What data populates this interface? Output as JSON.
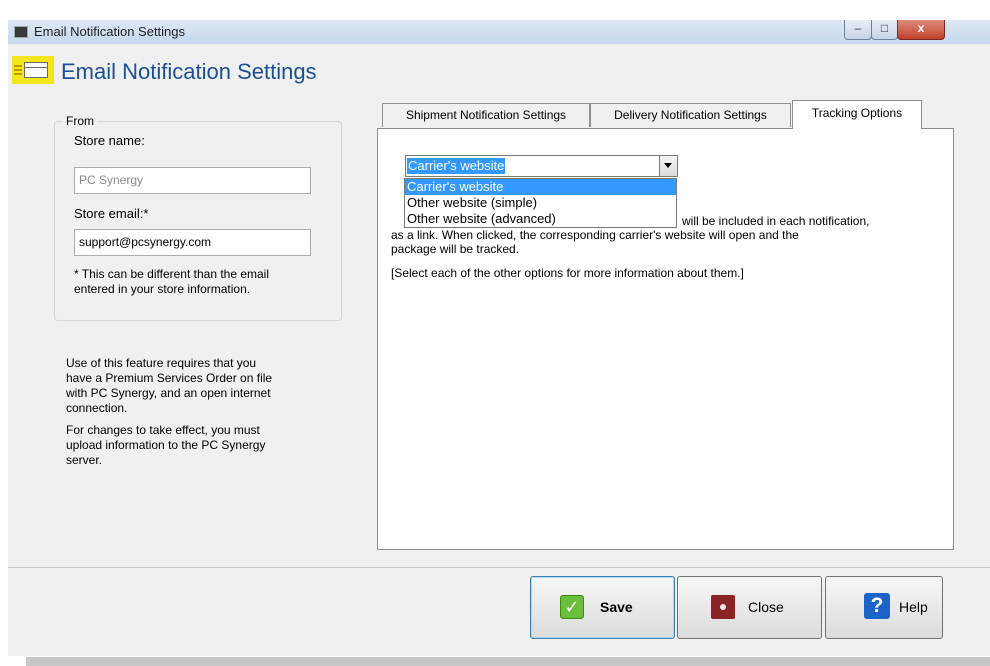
{
  "window": {
    "title": "Email Notification Settings",
    "controls": {
      "minimize": "–",
      "maximize": "□",
      "close": "x"
    }
  },
  "header": {
    "title": "Email Notification Settings",
    "icon": "envelope-icon"
  },
  "from": {
    "legend": "From",
    "store_name_label": "Store name:",
    "store_name_placeholder": "PC Synergy",
    "store_email_label": "Store email:*",
    "store_email_value": "support@pcsynergy.com",
    "note_line1": "* This can be different than the email",
    "note_line2": "entered in your store information."
  },
  "info": {
    "p1": [
      "Use of this feature requires that you",
      "have a Premium Services Order on file",
      "with PC Synergy, and an open internet",
      "connection."
    ],
    "p2": [
      "For changes to take effect, you must",
      "upload information to the PC Synergy",
      "server."
    ]
  },
  "tabs": [
    {
      "label": "Shipment Notification Settings",
      "active": false
    },
    {
      "label": "Delivery Notification Settings",
      "active": false
    },
    {
      "label": "Tracking Options",
      "active": true
    }
  ],
  "tracking": {
    "selected": "Carrier's website",
    "options": [
      "Carrier's website",
      "Other website (simple)",
      "Other website (advanced)"
    ],
    "desc_line1_tail": "will be included in each notification,",
    "desc_line2": "as a link.  When clicked, the corresponding carrier's website will open and the",
    "desc_line3": "package will be tracked.",
    "desc_line4": "[Select each of the other options for more information about them.]"
  },
  "buttons": {
    "save": "Save",
    "close": "Close",
    "help": "Help"
  },
  "icons": {
    "save": "checkmark-icon",
    "close": "stop-icon",
    "help": "question-icon"
  }
}
